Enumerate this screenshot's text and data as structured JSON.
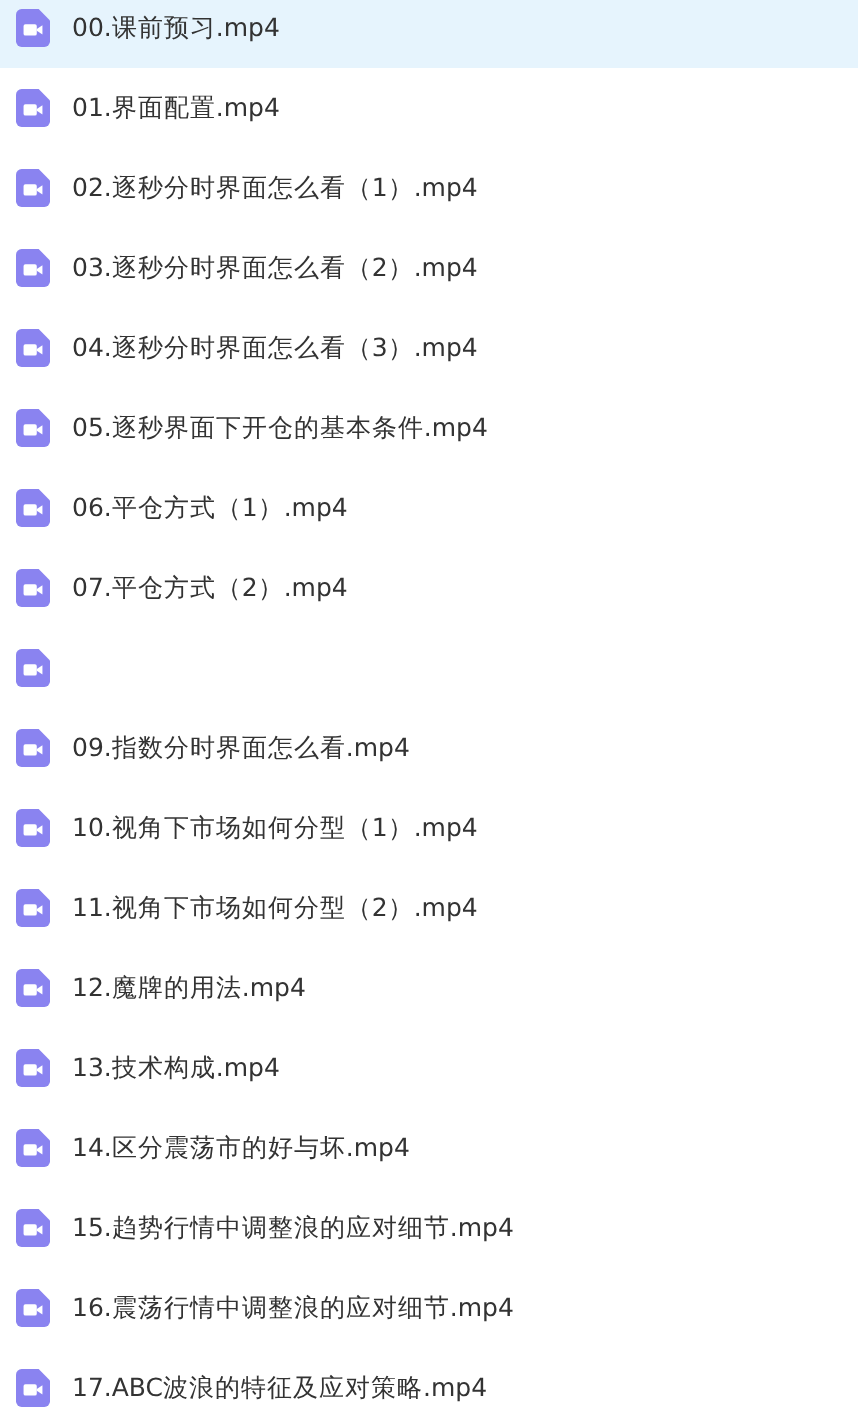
{
  "files": [
    {
      "name": "00.课前预习.mp4",
      "selected": true
    },
    {
      "name": "01.界面配置.mp4",
      "selected": false
    },
    {
      "name": "02.逐秒分时界面怎么看（1）.mp4",
      "selected": false
    },
    {
      "name": "03.逐秒分时界面怎么看（2）.mp4",
      "selected": false
    },
    {
      "name": "04.逐秒分时界面怎么看（3）.mp4",
      "selected": false
    },
    {
      "name": "05.逐秒界面下开仓的基本条件.mp4",
      "selected": false
    },
    {
      "name": "06.平仓方式（1）.mp4",
      "selected": false
    },
    {
      "name": "07.平仓方式（2）.mp4",
      "selected": false
    },
    {
      "selected": false
    },
    {
      "name": "09.指数分时界面怎么看.mp4",
      "selected": false
    },
    {
      "name": "10.视角下市场如何分型（1）.mp4",
      "selected": false
    },
    {
      "name": "11.视角下市场如何分型（2）.mp4",
      "selected": false
    },
    {
      "name": "12.魔牌的用法.mp4",
      "selected": false
    },
    {
      "name": "13.技术构成.mp4",
      "selected": false
    },
    {
      "name": "14.区分震荡市的好与坏.mp4",
      "selected": false
    },
    {
      "name": "15.趋势行情中调整浪的应对细节.mp4",
      "selected": false
    },
    {
      "name": "16.震荡行情中调整浪的应对细节.mp4",
      "selected": false
    },
    {
      "name": "17.ABC波浪的特征及应对策略.mp4",
      "selected": false
    }
  ]
}
